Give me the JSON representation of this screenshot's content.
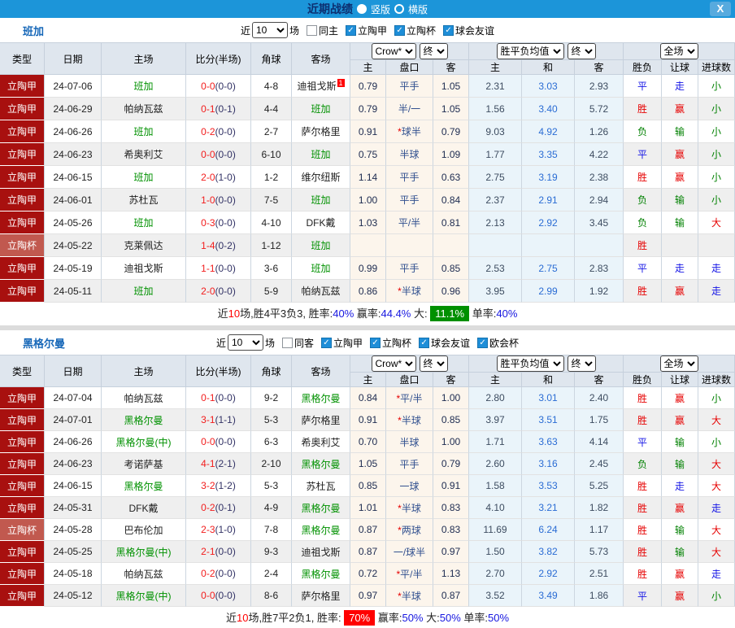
{
  "titlebar": {
    "title": "近期战绩",
    "layout_vertical": "竖版",
    "layout_horizontal": "横版",
    "close": "X"
  },
  "colors": {
    "titlebar_blue": "#1c95d9",
    "league_red": "#a8100f",
    "cup_red": "#c1594f",
    "focus_team_green": "#009100",
    "win_red": "#e60000",
    "draw_blue": "#1414e6",
    "lose_green": "#008000"
  },
  "filters_shared": {
    "near": "近",
    "count": "10",
    "games": "场"
  },
  "table": {
    "columns": [
      "类型",
      "日期",
      "主场",
      "比分(半场)",
      "角球",
      "客场"
    ],
    "sub": [
      "主",
      "盘口",
      "客",
      "主",
      "和",
      "客",
      "胜负",
      "让球",
      "进球数"
    ],
    "selects": {
      "crow": "Crow*",
      "final1": "终",
      "avg": "胜平负均值",
      "final2": "终",
      "scope": "全场"
    }
  },
  "sections": [
    {
      "team": "班加",
      "same": "同主",
      "same_checked": false,
      "leagues": [
        "立陶甲",
        "立陶杯",
        "球会友谊"
      ],
      "rows": [
        {
          "lg": "立陶甲",
          "cup": false,
          "date": "24-07-06",
          "home": "班加",
          "hf": true,
          "ft": "0-0",
          "ht": "(0-0)",
          "cn": "4-8",
          "away": "迪祖戈斯",
          "af": false,
          "rc": "1",
          "o1": "0.79",
          "star": false,
          "pan": "平手",
          "o2": "1.05",
          "m1": "2.31",
          "m2": "3.03",
          "m3": "2.93",
          "res": [
            "平",
            "b"
          ],
          "ab": [
            "走",
            "b"
          ],
          "ou": [
            "小",
            "g"
          ]
        },
        {
          "lg": "立陶甲",
          "cup": false,
          "date": "24-06-29",
          "home": "帕纳瓦兹",
          "hf": false,
          "ft": "0-1",
          "ht": "(0-1)",
          "cn": "4-4",
          "away": "班加",
          "af": true,
          "rc": "",
          "o1": "0.79",
          "star": false,
          "pan": "半/一",
          "o2": "1.05",
          "m1": "1.56",
          "m2": "3.40",
          "m3": "5.72",
          "res": [
            "胜",
            "r"
          ],
          "ab": [
            "赢",
            "r"
          ],
          "ou": [
            "小",
            "g"
          ]
        },
        {
          "lg": "立陶甲",
          "cup": false,
          "date": "24-06-26",
          "home": "班加",
          "hf": true,
          "ft": "0-2",
          "ht": "(0-0)",
          "cn": "2-7",
          "away": "萨尔格里",
          "af": false,
          "rc": "",
          "o1": "0.91",
          "star": true,
          "pan": "球半",
          "o2": "0.79",
          "m1": "9.03",
          "m2": "4.92",
          "m3": "1.26",
          "res": [
            "负",
            "g"
          ],
          "ab": [
            "输",
            "g"
          ],
          "ou": [
            "小",
            "g"
          ]
        },
        {
          "lg": "立陶甲",
          "cup": false,
          "date": "24-06-23",
          "home": "希奥利艾",
          "hf": false,
          "ft": "0-0",
          "ht": "(0-0)",
          "cn": "6-10",
          "away": "班加",
          "af": true,
          "rc": "",
          "o1": "0.75",
          "star": false,
          "pan": "半球",
          "o2": "1.09",
          "m1": "1.77",
          "m2": "3.35",
          "m3": "4.22",
          "res": [
            "平",
            "b"
          ],
          "ab": [
            "赢",
            "r"
          ],
          "ou": [
            "小",
            "g"
          ]
        },
        {
          "lg": "立陶甲",
          "cup": false,
          "date": "24-06-15",
          "home": "班加",
          "hf": true,
          "ft": "2-0",
          "ht": "(1-0)",
          "cn": "1-2",
          "away": "维尔纽斯",
          "af": false,
          "rc": "",
          "o1": "1.14",
          "star": false,
          "pan": "平手",
          "o2": "0.63",
          "m1": "2.75",
          "m2": "3.19",
          "m3": "2.38",
          "res": [
            "胜",
            "r"
          ],
          "ab": [
            "赢",
            "r"
          ],
          "ou": [
            "小",
            "g"
          ]
        },
        {
          "lg": "立陶甲",
          "cup": false,
          "date": "24-06-01",
          "home": "苏杜瓦",
          "hf": false,
          "ft": "1-0",
          "ht": "(0-0)",
          "cn": "7-5",
          "away": "班加",
          "af": true,
          "rc": "",
          "o1": "1.00",
          "star": false,
          "pan": "平手",
          "o2": "0.84",
          "m1": "2.37",
          "m2": "2.91",
          "m3": "2.94",
          "res": [
            "负",
            "g"
          ],
          "ab": [
            "输",
            "g"
          ],
          "ou": [
            "小",
            "g"
          ]
        },
        {
          "lg": "立陶甲",
          "cup": false,
          "date": "24-05-26",
          "home": "班加",
          "hf": true,
          "ft": "0-3",
          "ht": "(0-0)",
          "cn": "4-10",
          "away": "DFK戴",
          "af": false,
          "rc": "",
          "o1": "1.03",
          "star": false,
          "pan": "平/半",
          "o2": "0.81",
          "m1": "2.13",
          "m2": "2.92",
          "m3": "3.45",
          "res": [
            "负",
            "g"
          ],
          "ab": [
            "输",
            "g"
          ],
          "ou": [
            "大",
            "r"
          ]
        },
        {
          "lg": "立陶杯",
          "cup": true,
          "date": "24-05-22",
          "home": "克莱佩达",
          "hf": false,
          "ft": "1-4",
          "ht": "(0-2)",
          "cn": "1-12",
          "away": "班加",
          "af": true,
          "rc": "",
          "o1": "",
          "star": false,
          "pan": "",
          "o2": "",
          "m1": "",
          "m2": "",
          "m3": "",
          "res": [
            "胜",
            "r"
          ],
          "ab": [
            "",
            ""
          ],
          "ou": [
            "",
            ""
          ]
        },
        {
          "lg": "立陶甲",
          "cup": false,
          "date": "24-05-19",
          "home": "迪祖戈斯",
          "hf": false,
          "ft": "1-1",
          "ht": "(0-0)",
          "cn": "3-6",
          "away": "班加",
          "af": true,
          "rc": "",
          "o1": "0.99",
          "star": false,
          "pan": "平手",
          "o2": "0.85",
          "m1": "2.53",
          "m2": "2.75",
          "m3": "2.83",
          "res": [
            "平",
            "b"
          ],
          "ab": [
            "走",
            "b"
          ],
          "ou": [
            "走",
            "b"
          ]
        },
        {
          "lg": "立陶甲",
          "cup": false,
          "date": "24-05-11",
          "home": "班加",
          "hf": true,
          "ft": "2-0",
          "ht": "(0-0)",
          "cn": "5-9",
          "away": "帕纳瓦兹",
          "af": false,
          "rc": "",
          "o1": "0.86",
          "star": true,
          "pan": "半球",
          "o2": "0.96",
          "m1": "3.95",
          "m2": "2.99",
          "m3": "1.92",
          "res": [
            "胜",
            "r"
          ],
          "ab": [
            "赢",
            "r"
          ],
          "ou": [
            "走",
            "b"
          ]
        }
      ],
      "summary": [
        {
          "t": "近"
        },
        {
          "t": "10",
          "c": "red"
        },
        {
          "t": "场,胜4平3负3, 胜率:"
        },
        {
          "t": "40%",
          "c": "blue"
        },
        {
          "t": " 赢率:"
        },
        {
          "t": "44.4%",
          "c": "blue"
        },
        {
          "t": " 大: "
        },
        {
          "t": "11.1%",
          "c": "greenbox"
        },
        {
          "t": " 单率:"
        },
        {
          "t": "40%",
          "c": "blue"
        }
      ]
    },
    {
      "team": "黑格尔曼",
      "same": "同客",
      "same_checked": false,
      "leagues": [
        "立陶甲",
        "立陶杯",
        "球会友谊",
        "欧会杯"
      ],
      "rows": [
        {
          "lg": "立陶甲",
          "cup": false,
          "date": "24-07-04",
          "home": "帕纳瓦兹",
          "hf": false,
          "ft": "0-1",
          "ht": "(0-0)",
          "cn": "9-2",
          "away": "黑格尔曼",
          "af": true,
          "rc": "",
          "o1": "0.84",
          "star": true,
          "pan": "平/半",
          "o2": "1.00",
          "m1": "2.80",
          "m2": "3.01",
          "m3": "2.40",
          "res": [
            "胜",
            "r"
          ],
          "ab": [
            "赢",
            "r"
          ],
          "ou": [
            "小",
            "g"
          ]
        },
        {
          "lg": "立陶甲",
          "cup": false,
          "date": "24-07-01",
          "home": "黑格尔曼",
          "hf": true,
          "ft": "3-1",
          "ht": "(1-1)",
          "cn": "5-3",
          "away": "萨尔格里",
          "af": false,
          "rc": "",
          "o1": "0.91",
          "star": true,
          "pan": "半球",
          "o2": "0.85",
          "m1": "3.97",
          "m2": "3.51",
          "m3": "1.75",
          "res": [
            "胜",
            "r"
          ],
          "ab": [
            "赢",
            "r"
          ],
          "ou": [
            "大",
            "r"
          ]
        },
        {
          "lg": "立陶甲",
          "cup": false,
          "date": "24-06-26",
          "home": "黑格尔曼(中)",
          "hf": true,
          "ft": "0-0",
          "ht": "(0-0)",
          "cn": "6-3",
          "away": "希奥利艾",
          "af": false,
          "rc": "",
          "o1": "0.70",
          "star": false,
          "pan": "半球",
          "o2": "1.00",
          "m1": "1.71",
          "m2": "3.63",
          "m3": "4.14",
          "res": [
            "平",
            "b"
          ],
          "ab": [
            "输",
            "g"
          ],
          "ou": [
            "小",
            "g"
          ]
        },
        {
          "lg": "立陶甲",
          "cup": false,
          "date": "24-06-23",
          "home": "考诺萨基",
          "hf": false,
          "ft": "4-1",
          "ht": "(2-1)",
          "cn": "2-10",
          "away": "黑格尔曼",
          "af": true,
          "rc": "",
          "o1": "1.05",
          "star": false,
          "pan": "平手",
          "o2": "0.79",
          "m1": "2.60",
          "m2": "3.16",
          "m3": "2.45",
          "res": [
            "负",
            "g"
          ],
          "ab": [
            "输",
            "g"
          ],
          "ou": [
            "大",
            "r"
          ]
        },
        {
          "lg": "立陶甲",
          "cup": false,
          "date": "24-06-15",
          "home": "黑格尔曼",
          "hf": true,
          "ft": "3-2",
          "ht": "(1-2)",
          "cn": "5-3",
          "away": "苏杜瓦",
          "af": false,
          "rc": "",
          "o1": "0.85",
          "star": false,
          "pan": "一球",
          "o2": "0.91",
          "m1": "1.58",
          "m2": "3.53",
          "m3": "5.25",
          "res": [
            "胜",
            "r"
          ],
          "ab": [
            "走",
            "b"
          ],
          "ou": [
            "大",
            "r"
          ]
        },
        {
          "lg": "立陶甲",
          "cup": false,
          "date": "24-05-31",
          "home": "DFK戴",
          "hf": false,
          "ft": "0-2",
          "ht": "(0-1)",
          "cn": "4-9",
          "away": "黑格尔曼",
          "af": true,
          "rc": "",
          "o1": "1.01",
          "star": true,
          "pan": "半球",
          "o2": "0.83",
          "m1": "4.10",
          "m2": "3.21",
          "m3": "1.82",
          "res": [
            "胜",
            "r"
          ],
          "ab": [
            "赢",
            "r"
          ],
          "ou": [
            "走",
            "b"
          ]
        },
        {
          "lg": "立陶杯",
          "cup": true,
          "date": "24-05-28",
          "home": "巴布伦加",
          "hf": false,
          "ft": "2-3",
          "ht": "(1-0)",
          "cn": "7-8",
          "away": "黑格尔曼",
          "af": true,
          "rc": "",
          "o1": "0.87",
          "star": true,
          "pan": "两球",
          "o2": "0.83",
          "m1": "11.69",
          "m2": "6.24",
          "m3": "1.17",
          "res": [
            "胜",
            "r"
          ],
          "ab": [
            "输",
            "g"
          ],
          "ou": [
            "大",
            "r"
          ]
        },
        {
          "lg": "立陶甲",
          "cup": false,
          "date": "24-05-25",
          "home": "黑格尔曼(中)",
          "hf": true,
          "ft": "2-1",
          "ht": "(0-0)",
          "cn": "9-3",
          "away": "迪祖戈斯",
          "af": false,
          "rc": "",
          "o1": "0.87",
          "star": false,
          "pan": "一/球半",
          "o2": "0.97",
          "m1": "1.50",
          "m2": "3.82",
          "m3": "5.73",
          "res": [
            "胜",
            "r"
          ],
          "ab": [
            "输",
            "g"
          ],
          "ou": [
            "大",
            "r"
          ]
        },
        {
          "lg": "立陶甲",
          "cup": false,
          "date": "24-05-18",
          "home": "帕纳瓦兹",
          "hf": false,
          "ft": "0-2",
          "ht": "(0-0)",
          "cn": "2-4",
          "away": "黑格尔曼",
          "af": true,
          "rc": "",
          "o1": "0.72",
          "star": true,
          "pan": "平/半",
          "o2": "1.13",
          "m1": "2.70",
          "m2": "2.92",
          "m3": "2.51",
          "res": [
            "胜",
            "r"
          ],
          "ab": [
            "赢",
            "r"
          ],
          "ou": [
            "走",
            "b"
          ]
        },
        {
          "lg": "立陶甲",
          "cup": false,
          "date": "24-05-12",
          "home": "黑格尔曼(中)",
          "hf": true,
          "ft": "0-0",
          "ht": "(0-0)",
          "cn": "8-6",
          "away": "萨尔格里",
          "af": false,
          "rc": "",
          "o1": "0.97",
          "star": true,
          "pan": "半球",
          "o2": "0.87",
          "m1": "3.52",
          "m2": "3.49",
          "m3": "1.86",
          "res": [
            "平",
            "b"
          ],
          "ab": [
            "赢",
            "r"
          ],
          "ou": [
            "小",
            "g"
          ]
        }
      ],
      "summary": [
        {
          "t": "近"
        },
        {
          "t": "10",
          "c": "red"
        },
        {
          "t": "场,胜7平2负1, 胜率: "
        },
        {
          "t": "70%",
          "c": "redbox"
        },
        {
          "t": " 赢率:"
        },
        {
          "t": "50%",
          "c": "blue"
        },
        {
          "t": " 大:"
        },
        {
          "t": "50%",
          "c": "blue"
        },
        {
          "t": " 单率:"
        },
        {
          "t": "50%",
          "c": "blue"
        }
      ]
    }
  ]
}
